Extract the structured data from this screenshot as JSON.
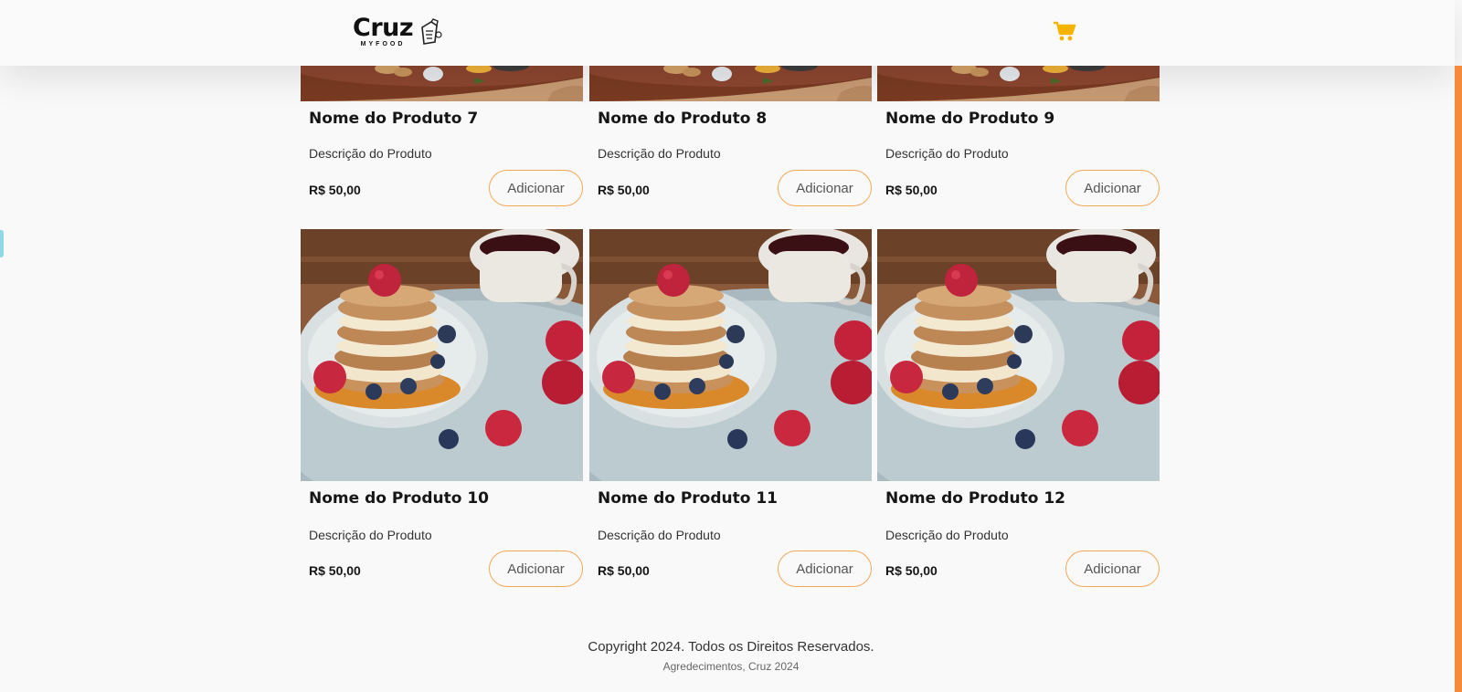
{
  "header": {
    "logo_name": "Cruz",
    "logo_sub": "MYFOOD",
    "cart_icon": "shopping-cart-icon",
    "cart_color": "#f4b400"
  },
  "products": [
    {
      "name": "Nome do Produto 7",
      "description": "Descrição do Produto",
      "price": "R$ 50,00",
      "button": "Adicionar"
    },
    {
      "name": "Nome do Produto 8",
      "description": "Descrição do Produto",
      "price": "R$ 50,00",
      "button": "Adicionar"
    },
    {
      "name": "Nome do Produto 9",
      "description": "Descrição do Produto",
      "price": "R$ 50,00",
      "button": "Adicionar"
    },
    {
      "name": "Nome do Produto 10",
      "description": "Descrição do Produto",
      "price": "R$ 50,00",
      "button": "Adicionar"
    },
    {
      "name": "Nome do Produto 11",
      "description": "Descrição do Produto",
      "price": "R$ 50,00",
      "button": "Adicionar"
    },
    {
      "name": "Nome do Produto 12",
      "description": "Descrição do Produto",
      "price": "R$ 50,00",
      "button": "Adicionar"
    }
  ],
  "footer": {
    "copyright": "Copyright 2024. Todos os Direitos Reservados.",
    "thanks": "Agredecimentos, Cruz 2024"
  },
  "colors": {
    "accent": "#f58a3a",
    "button_border": "#f3a858",
    "background": "#f9f9f9"
  }
}
